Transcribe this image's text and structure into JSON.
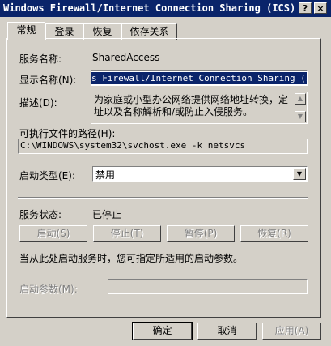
{
  "window": {
    "title": "Windows Firewall/Internet Connection Sharing (ICS)...",
    "help_label": "?",
    "close_label": "×"
  },
  "tabs": [
    {
      "label": "常规",
      "active": true
    },
    {
      "label": "登录",
      "active": false
    },
    {
      "label": "恢复",
      "active": false
    },
    {
      "label": "依存关系",
      "active": false
    }
  ],
  "general": {
    "service_name_label": "服务名称:",
    "service_name_value": "SharedAccess",
    "display_name_label": "显示名称(N):",
    "display_name_value": "s Firewall/Internet Connection Sharing (ICS)",
    "description_label": "描述(D):",
    "description_value": "为家庭或小型办公网络提供网络地址转换，定址以及名称解析和/或防止入侵服务。",
    "exec_path_label": "可执行文件的路径(H):",
    "exec_path_value": "C:\\WINDOWS\\system32\\svchost.exe -k netsvcs",
    "startup_type_label": "启动类型(E):",
    "startup_type_value": "禁用",
    "service_status_label": "服务状态:",
    "service_status_value": "已停止",
    "start_button": "启动(S)",
    "stop_button": "停止(T)",
    "pause_button": "暂停(P)",
    "resume_button": "恢复(R)",
    "hint_text": "当从此处启动服务时，您可指定所适用的启动参数。",
    "start_params_label": "启动参数(M):",
    "start_params_value": ""
  },
  "footer": {
    "ok_label": "确定",
    "cancel_label": "取消",
    "apply_label": "应用(A)"
  }
}
